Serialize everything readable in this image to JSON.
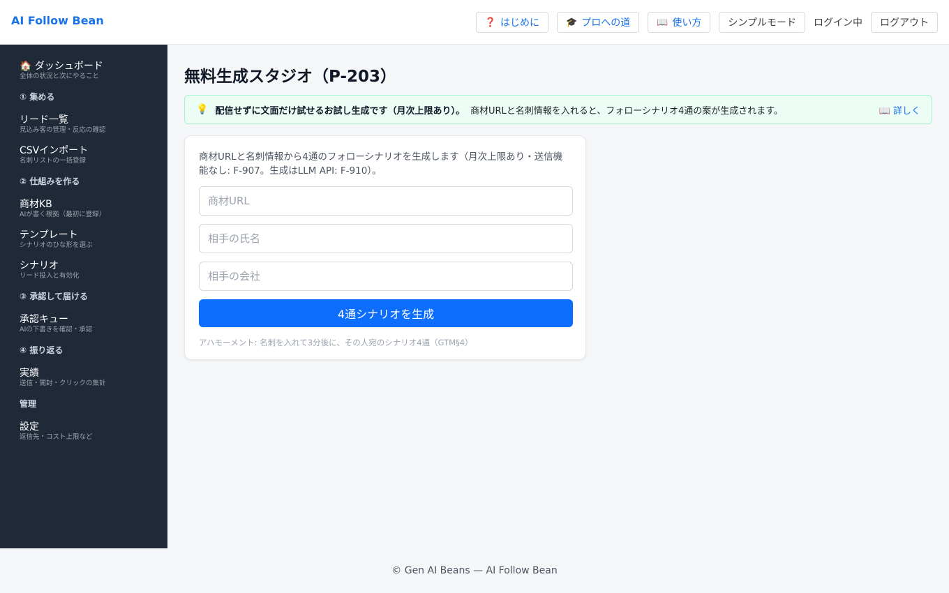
{
  "app": {
    "brand": "AI Follow Bean"
  },
  "header": {
    "buttons": [
      {
        "icon": "❓",
        "label": "はじめに"
      },
      {
        "icon": "🎓",
        "label": "プロへの道"
      },
      {
        "icon": "📖",
        "label": "使い方"
      }
    ],
    "simple_mode": "シンプルモード",
    "login_status": "ログイン中",
    "logout": "ログアウト"
  },
  "sidebar": {
    "dashboard": {
      "label": "🏠 ダッシュボード",
      "sub": "全体の状況と次にやること"
    },
    "section1": "① 集める",
    "leads": {
      "label": "リード一覧",
      "sub": "見込み客の管理・反応の確認"
    },
    "csv": {
      "label": "CSVインポート",
      "sub": "名刺リストの一括登録"
    },
    "section2": "② 仕組みを作る",
    "kb": {
      "label": "商材KB",
      "sub": "AIが書く根拠（最初に登録）"
    },
    "templates": {
      "label": "テンプレート",
      "sub": "シナリオのひな形を選ぶ"
    },
    "scenarios": {
      "label": "シナリオ",
      "sub": "リード投入と有効化"
    },
    "section3": "③ 承認して届ける",
    "queue": {
      "label": "承認キュー",
      "sub": "AIの下書きを確認・承認"
    },
    "section4": "④ 振り返る",
    "results": {
      "label": "実績",
      "sub": "送信・開封・クリックの集計"
    },
    "section5": "管理",
    "settings": {
      "label": "設定",
      "sub": "返信先・コスト上限など"
    }
  },
  "main": {
    "title": "無料生成スタジオ（P-203）",
    "banner": {
      "icon": "💡",
      "bold": "配信せずに文面だけ試せるお試し生成です（月次上限あり）。",
      "desc": "商材URLと名刺情報を入れると、フォローシナリオ4通の案が生成されます。",
      "more": "📖 詳しく"
    },
    "card": {
      "intro": "商材URLと名刺情報から4通のフォローシナリオを生成します（月次上限あり・送信機能なし: F-907。生成はLLM API: F-910）。",
      "product_url_placeholder": "商材URL",
      "name_placeholder": "相手の氏名",
      "company_placeholder": "相手の会社",
      "generate_button": "4通シナリオを生成",
      "note": "アハモーメント: 名刺を入れて3分後に、その人宛のシナリオ4通（GTM§4）"
    }
  },
  "footer": {
    "text": "© Gen AI Beans — AI Follow Bean"
  }
}
